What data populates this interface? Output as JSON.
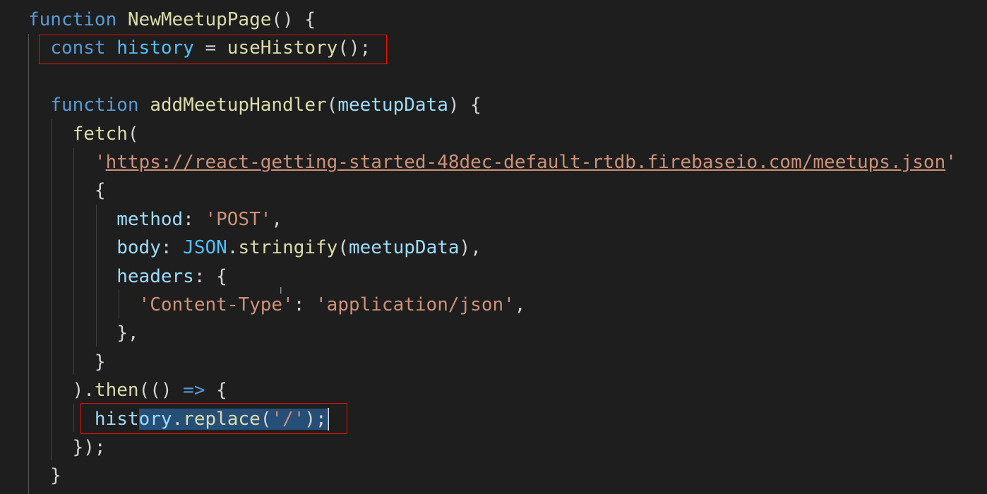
{
  "editor": {
    "lines": [
      [
        {
          "t": "function",
          "c": "k"
        },
        {
          "t": " ",
          "c": "p"
        },
        {
          "t": "NewMeetupPage",
          "c": "f"
        },
        {
          "t": "() {",
          "c": "p"
        }
      ],
      [
        {
          "t": "  ",
          "c": "p"
        },
        {
          "t": "const",
          "c": "k"
        },
        {
          "t": " ",
          "c": "p"
        },
        {
          "t": "history",
          "c": "c"
        },
        {
          "t": " = ",
          "c": "p"
        },
        {
          "t": "useHistory",
          "c": "f"
        },
        {
          "t": "();",
          "c": "p"
        }
      ],
      [],
      [
        {
          "t": "  ",
          "c": "p"
        },
        {
          "t": "function",
          "c": "k"
        },
        {
          "t": " ",
          "c": "p"
        },
        {
          "t": "addMeetupHandler",
          "c": "f"
        },
        {
          "t": "(",
          "c": "p"
        },
        {
          "t": "meetupData",
          "c": "v"
        },
        {
          "t": ") {",
          "c": "p"
        }
      ],
      [
        {
          "t": "    ",
          "c": "p"
        },
        {
          "t": "fetch",
          "c": "f"
        },
        {
          "t": "(",
          "c": "p"
        }
      ],
      [
        {
          "t": "      ",
          "c": "p"
        },
        {
          "t": "'",
          "c": "s"
        },
        {
          "t": "https://react-getting-started-48dec-default-rtdb.firebaseio.com/meetups.json",
          "c": "s",
          "u": true
        },
        {
          "t": "'",
          "c": "s"
        }
      ],
      [
        {
          "t": "      {",
          "c": "p"
        }
      ],
      [
        {
          "t": "        ",
          "c": "p"
        },
        {
          "t": "method",
          "c": "v"
        },
        {
          "t": ": ",
          "c": "p"
        },
        {
          "t": "'POST'",
          "c": "s"
        },
        {
          "t": ",",
          "c": "p"
        }
      ],
      [
        {
          "t": "        ",
          "c": "p"
        },
        {
          "t": "body",
          "c": "v"
        },
        {
          "t": ": ",
          "c": "p"
        },
        {
          "t": "JSON",
          "c": "c"
        },
        {
          "t": ".",
          "c": "p"
        },
        {
          "t": "stringify",
          "c": "f"
        },
        {
          "t": "(",
          "c": "p"
        },
        {
          "t": "meetupData",
          "c": "v"
        },
        {
          "t": "),",
          "c": "p"
        }
      ],
      [
        {
          "t": "        ",
          "c": "p"
        },
        {
          "t": "headers",
          "c": "v"
        },
        {
          "t": ": {",
          "c": "p"
        }
      ],
      [
        {
          "t": "          ",
          "c": "p"
        },
        {
          "t": "'Content-Type'",
          "c": "s"
        },
        {
          "t": ": ",
          "c": "p"
        },
        {
          "t": "'application/json'",
          "c": "s"
        },
        {
          "t": ",",
          "c": "p"
        }
      ],
      [
        {
          "t": "        },",
          "c": "p"
        }
      ],
      [
        {
          "t": "      }",
          "c": "p"
        }
      ],
      [
        {
          "t": "    ).",
          "c": "p"
        },
        {
          "t": "then",
          "c": "f"
        },
        {
          "t": "(() ",
          "c": "p"
        },
        {
          "t": "=>",
          "c": "k"
        },
        {
          "t": " {",
          "c": "p"
        }
      ],
      [
        {
          "t": "      ",
          "c": "p"
        },
        {
          "t": "hist",
          "c": "v"
        },
        {
          "t": "ory",
          "c": "v",
          "sel": true
        },
        {
          "t": ".",
          "c": "p",
          "sel": true
        },
        {
          "t": "replace",
          "c": "f",
          "sel": true
        },
        {
          "t": "(",
          "c": "p",
          "sel": true
        },
        {
          "t": "'/'",
          "c": "s",
          "sel": true
        },
        {
          "t": ");",
          "c": "p",
          "sel": true
        },
        {
          "cursor": true
        }
      ],
      [
        {
          "t": "    });",
          "c": "p"
        }
      ],
      [
        {
          "t": "  }",
          "c": "p"
        }
      ]
    ]
  }
}
